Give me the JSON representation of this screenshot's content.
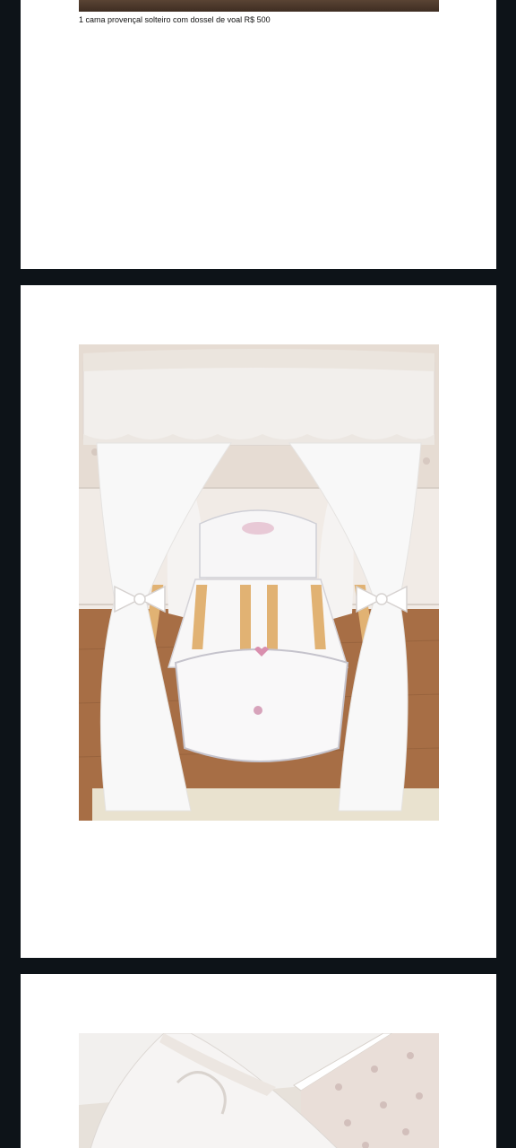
{
  "document": {
    "pages": [
      {
        "caption": "1 cama provençal solteiro com dossel de voal R$ 500"
      },
      {
        "image": "canopy-bed-photo"
      },
      {
        "image": "canopy-bed-photo-angle"
      }
    ]
  },
  "colors": {
    "viewer_background": "#0d1318",
    "page_background": "#ffffff"
  }
}
